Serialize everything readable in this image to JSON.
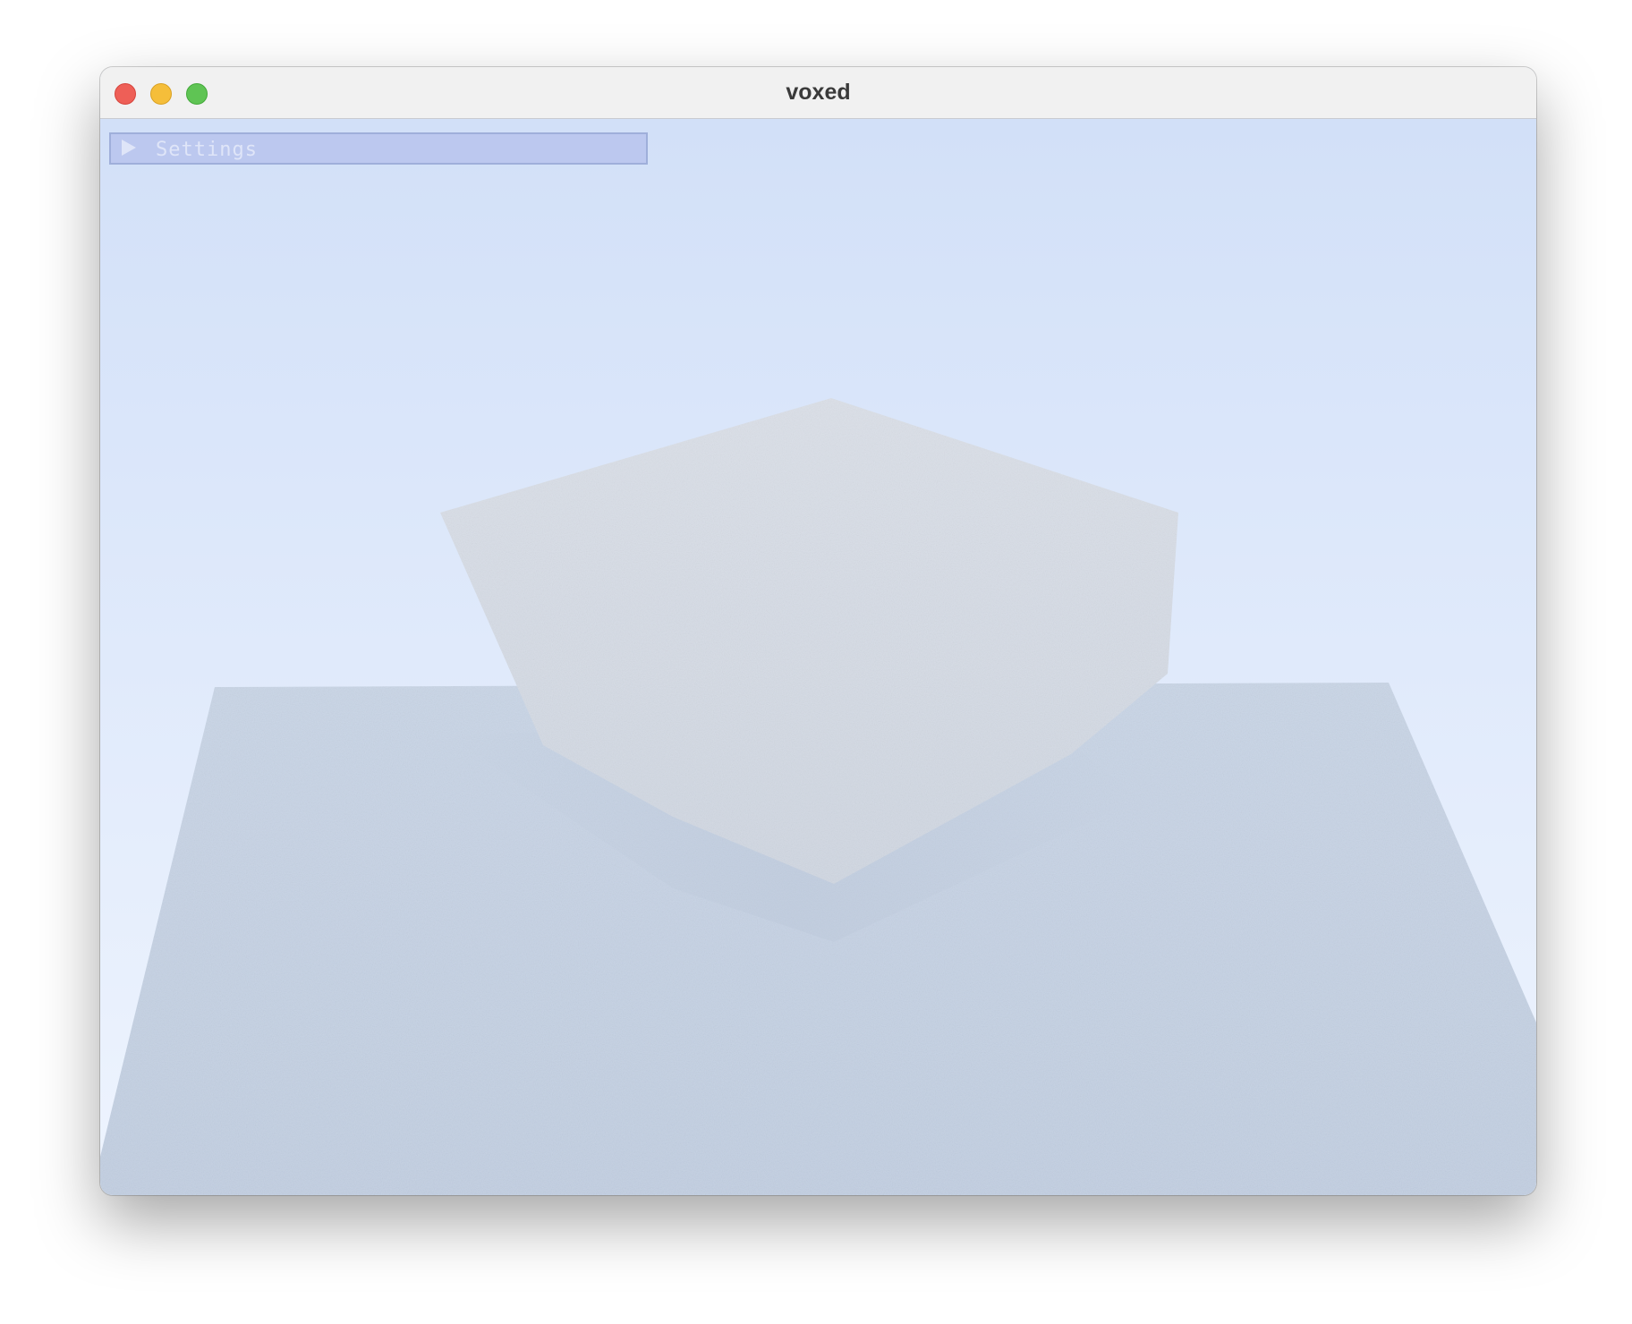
{
  "window": {
    "title": "voxed"
  },
  "settings_panel": {
    "label": "Settings",
    "collapsed": true
  },
  "scene": {
    "sky_top_color": "#d2e0f8",
    "sky_bottom_color": "#eef4fe",
    "ground_color": "#c5d2e4",
    "cube_color": "#d7dde6"
  }
}
